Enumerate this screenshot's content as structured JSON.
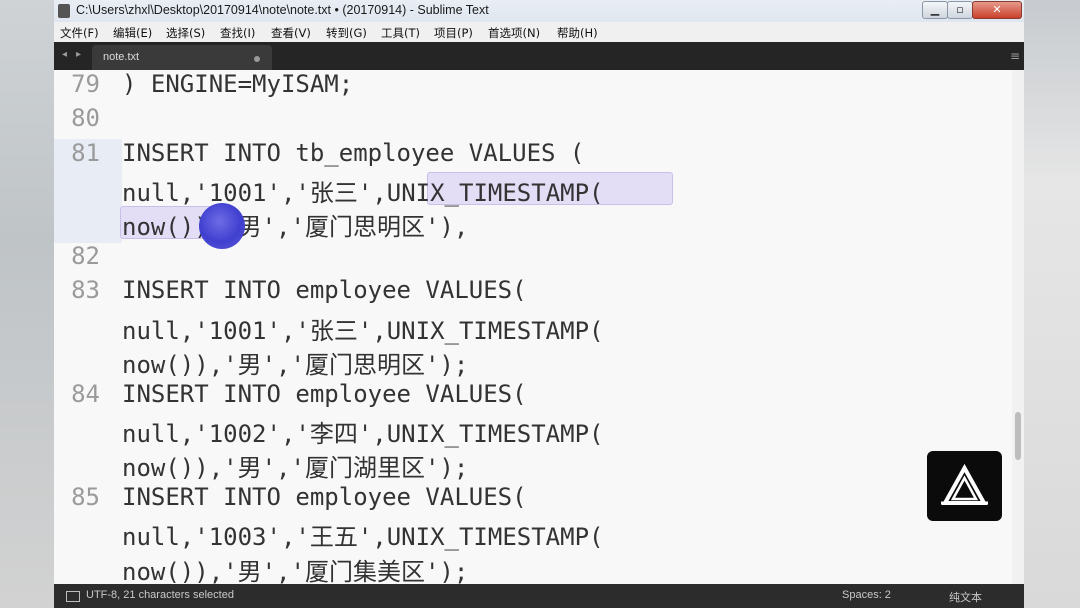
{
  "window": {
    "title": "C:\\Users\\zhxl\\Desktop\\20170914\\note\\note.txt • (20170914) - Sublime Text",
    "minimize_glyph": "▁",
    "maximize_glyph": "▫",
    "close_glyph": "✕"
  },
  "menu": [
    "文件(F)",
    "编辑(E)",
    "选择(S)",
    "查找(I)",
    "查看(V)",
    "转到(G)",
    "工具(T)",
    "项目(P)",
    "首选项(N)",
    "帮助(H)"
  ],
  "tabs": {
    "nav_left": "◂",
    "nav_right": "▸",
    "active_label": "note.txt",
    "menu_glyph": "≡"
  },
  "editor": {
    "line_numbers": {
      "l79": "79",
      "l80": "80",
      "l81": "81",
      "l82": "82",
      "l83": "83",
      "l84": "84",
      "l85": "85"
    },
    "lines": {
      "r0": ") ENGINE=MyISAM;",
      "r2": "INSERT INTO tb_employee VALUES (",
      "r3_pre": "null,'1001','张三',",
      "r3_sel": "UNIX_TIMESTAMP(",
      "r4_sel": "now())",
      "r4_post": ",'男','厦门思明区'),",
      "r6": "INSERT INTO employee VALUES(",
      "r7": "null,'1001','张三',UNIX_TIMESTAMP(",
      "r8": "now()),'男','厦门思明区');",
      "r9": "INSERT INTO employee VALUES(",
      "r10": "null,'1002','李四',UNIX_TIMESTAMP(",
      "r11": "now()),'男','厦门湖里区');",
      "r12": "INSERT INTO employee VALUES(",
      "r13": "null,'1003','王五',UNIX_TIMESTAMP(",
      "r14": "now()),'男','厦门集美区');"
    }
  },
  "status": {
    "selection": "UTF-8, 21 characters selected",
    "indent": "Spaces: 2",
    "syntax": "纯文本"
  },
  "colors": {
    "selection_bg": "#e3ddf6",
    "cursor_highlight": "#4040d0",
    "tabbar_bg": "#252525",
    "statusbar_bg": "#2c2c2c"
  }
}
